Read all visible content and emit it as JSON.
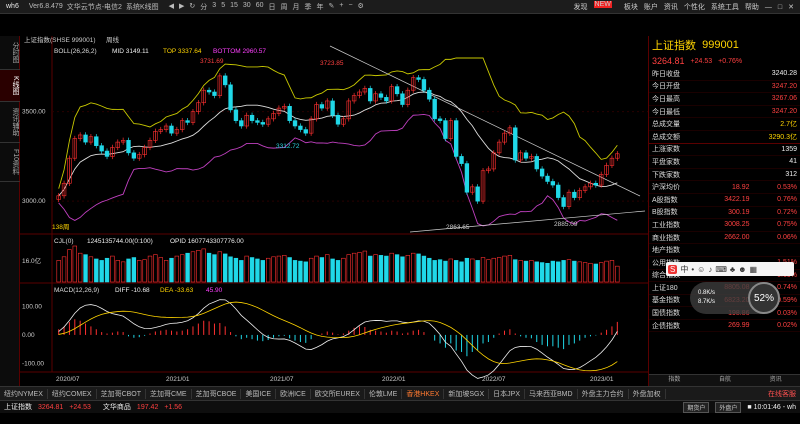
{
  "app": {
    "logo": "wh6",
    "version": "Ver6.8.479",
    "server": "文华云节点-电信2",
    "view": "系统K线图"
  },
  "right_menu": {
    "items": [
      "发现",
      "板块",
      "账户",
      "资讯",
      "个性化",
      "系统工具",
      "帮助"
    ],
    "new_badge": "NEW"
  },
  "left_tabs": [
    "分时图",
    "K线图",
    "资讯辅助",
    "F10资料"
  ],
  "chart_header": {
    "symbol_line": "上证指数(SHSE 999001)",
    "period": "周线",
    "boll": "BOLL(26,26,2)",
    "mid": "MID 3149.11",
    "top": "TOP 3337.64",
    "bottom": "BOTTOM 2960.57",
    "vol_header": "CJL(0)",
    "vol_value": "1245135744.00(0:100)",
    "opid": "OPID 1607743307776.00",
    "macd": "MACD(12,26,9)",
    "diff": "DIFF -10.68",
    "dea": "DEA -33.63",
    "macd_val": "45.90"
  },
  "chart_data": {
    "type": "candlestick",
    "y_ticks": [
      "3500.00",
      "3000.00"
    ],
    "vol_ticks": [
      "16.0亿"
    ],
    "macd_ticks": [
      "100.00",
      "0.00",
      "-100.00"
    ],
    "x_labels": [
      "2020/07",
      "2021/01",
      "2021/07",
      "2022/01",
      "2022/07",
      "2023/01"
    ],
    "annotations": [
      "3731.69",
      "3723.85",
      "3312.72",
      "2863.65",
      "2885.09",
      "138周"
    ],
    "ylim": [
      2850,
      3800
    ],
    "closes": [
      3030,
      3100,
      3240,
      3350,
      3370,
      3330,
      3360,
      3310,
      3280,
      3250,
      3300,
      3330,
      3340,
      3270,
      3240,
      3260,
      3300,
      3340,
      3390,
      3400,
      3420,
      3380,
      3400,
      3450,
      3440,
      3500,
      3550,
      3620,
      3610,
      3590,
      3700,
      3650,
      3510,
      3450,
      3420,
      3480,
      3450,
      3440,
      3430,
      3460,
      3490,
      3520,
      3530,
      3450,
      3420,
      3400,
      3380,
      3460,
      3540,
      3520,
      3560,
      3480,
      3430,
      3460,
      3560,
      3590,
      3610,
      3630,
      3560,
      3600,
      3580,
      3560,
      3640,
      3600,
      3540,
      3620,
      3690,
      3680,
      3620,
      3570,
      3460,
      3450,
      3350,
      3450,
      3250,
      3210,
      3050,
      3080,
      3000,
      3170,
      3180,
      3270,
      3330,
      3380,
      3410,
      3230,
      3270,
      3240,
      3250,
      3180,
      3140,
      3110,
      3090,
      3020,
      2970,
      3050,
      3020,
      3060,
      3080,
      3100,
      3090,
      3150,
      3200,
      3240,
      3264.81
    ],
    "volumes": [
      30,
      35,
      45,
      50,
      40,
      38,
      35,
      32,
      30,
      33,
      36,
      30,
      28,
      32,
      34,
      30,
      31,
      36,
      38,
      34,
      30,
      33,
      36,
      38,
      40,
      42,
      44,
      46,
      40,
      38,
      42,
      39,
      35,
      33,
      30,
      36,
      34,
      32,
      30,
      33,
      35,
      36,
      37,
      34,
      30,
      29,
      28,
      33,
      36,
      34,
      38,
      32,
      30,
      33,
      38,
      40,
      41,
      43,
      36,
      38,
      37,
      36,
      40,
      38,
      35,
      37,
      40,
      39,
      36,
      33,
      30,
      31,
      29,
      32,
      30,
      28,
      33,
      32,
      30,
      34,
      31,
      33,
      34,
      36,
      37,
      31,
      30,
      29,
      30,
      28,
      27,
      26,
      29,
      28,
      30,
      31,
      29,
      28,
      27,
      26,
      25,
      27,
      29,
      30,
      22
    ],
    "macd_bars": [
      20,
      30,
      45,
      55,
      50,
      40,
      30,
      20,
      10,
      5,
      8,
      12,
      10,
      -5,
      -10,
      -8,
      -3,
      5,
      12,
      15,
      18,
      15,
      12,
      15,
      20,
      30,
      40,
      50,
      48,
      40,
      42,
      30,
      10,
      -5,
      -15,
      -10,
      -15,
      -20,
      -22,
      -18,
      -10,
      -5,
      -3,
      -12,
      -20,
      -25,
      -28,
      -15,
      0,
      5,
      12,
      8,
      2,
      5,
      15,
      25,
      30,
      28,
      18,
      15,
      12,
      8,
      15,
      12,
      5,
      8,
      15,
      18,
      10,
      0,
      -20,
      -30,
      -45,
      -30,
      -55,
      -60,
      -75,
      -60,
      -55,
      -30,
      -25,
      -10,
      5,
      15,
      20,
      5,
      -5,
      -10,
      -12,
      -25,
      -35,
      -40,
      -40,
      -45,
      -50,
      -35,
      -30,
      -20,
      -10,
      -5,
      -2,
      8,
      18,
      30,
      45.9
    ]
  },
  "right_panel": {
    "title": "上证指数",
    "code": "999001",
    "price": "3264.81",
    "change": "+24.53",
    "pct": "+0.76%",
    "stats": [
      {
        "label": "昨日收盘",
        "value": "3240.28",
        "cls": "white"
      },
      {
        "label": "今日开盘",
        "value": "3247.20",
        "cls": "red"
      },
      {
        "label": "今日最高",
        "value": "3267.06",
        "cls": "red"
      },
      {
        "label": "今日最低",
        "value": "3247.20",
        "cls": "red"
      },
      {
        "label": "总成交量",
        "value": "2.7亿",
        "cls": "yellow"
      },
      {
        "label": "总成交额",
        "value": "3290.3亿",
        "cls": "yellow"
      },
      {
        "label": "上涨家数",
        "value": "1359",
        "cls": "white"
      },
      {
        "label": "平盘家数",
        "value": "41",
        "cls": "white"
      },
      {
        "label": "下跌家数",
        "value": "312",
        "cls": "white"
      }
    ],
    "indices": [
      {
        "name": "沪深均价",
        "value": "18.92",
        "pct": "0.53%"
      },
      {
        "name": "A股指数",
        "value": "3422.19",
        "pct": "0.76%"
      },
      {
        "name": "B股指数",
        "value": "300.19",
        "pct": "0.72%"
      },
      {
        "name": "工业指数",
        "value": "3008.25",
        "pct": "0.75%"
      },
      {
        "name": "商业指数",
        "value": "2662.00",
        "pct": "0.06%"
      },
      {
        "name": "地产指数",
        "value": "",
        "pct": ""
      },
      {
        "name": "公用指数",
        "value": "",
        "pct": "1.51%"
      },
      {
        "name": "综合指数",
        "value": "",
        "pct": "0.69%"
      },
      {
        "name": "上证180",
        "value": "8805.08",
        "pct": "0.74%"
      },
      {
        "name": "基金指数",
        "value": "6823.20",
        "pct": "0.59%"
      },
      {
        "name": "国债指数",
        "value": "198.86",
        "pct": "0.03%"
      },
      {
        "name": "企债指数",
        "value": "269.99",
        "pct": "0.02%"
      }
    ],
    "tabs": [
      "指数",
      "自航",
      "资讯"
    ]
  },
  "overlay": {
    "speed_pct": "52%",
    "up": "0.8K/s",
    "down": "8.7K/s"
  },
  "bottom_tabs": [
    "纽约NYMEX",
    "纽约COMEX",
    "芝加哥CBOT",
    "芝加哥CME",
    "芝加哥CBOE",
    "美国ICE",
    "欧洲ICE",
    "欧交所EUREX",
    "伦敦LME",
    "香港HKEX",
    "新加坡SGX",
    "日本JPX",
    "马来西亚BMD",
    "外盘主力合约",
    "外盘加权"
  ],
  "bottom_active": "香港HKEX",
  "bottom_right": "在线客服",
  "status": {
    "idx_name": "上证指数",
    "idx_price": "3264.81",
    "idx_chg": "+24.53",
    "comm_name": "文华商品",
    "comm_price": "197.42",
    "comm_chg": "+1.56",
    "btn1": "期货户",
    "btn2": "外盘户",
    "time": "10:01:46 - wh"
  }
}
